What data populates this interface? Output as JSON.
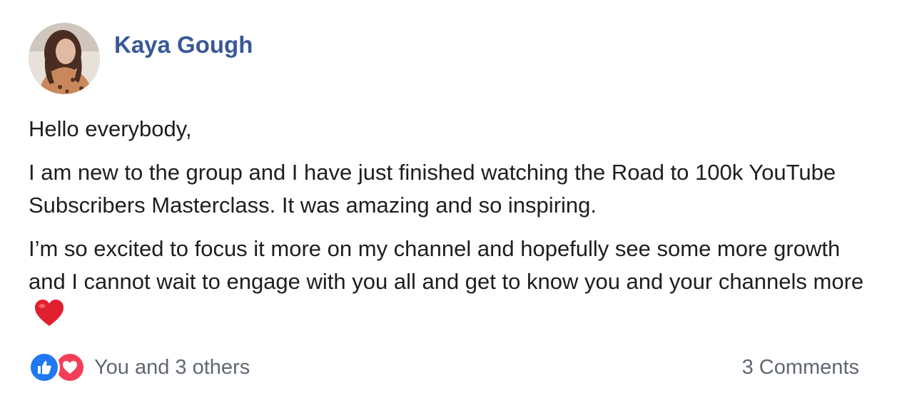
{
  "post": {
    "author_name": "Kaya Gough",
    "avatar_icon": "profile-photo",
    "paragraphs": [
      "Hello everybody,",
      "I am new to the group and I have just finished watching the Road to 100k YouTube Subscribers Masterclass. It was amazing and so inspiring.",
      "I’m so excited to focus it more on my channel and hopefully see some more growth and I cannot wait to engage with you all and get to know you and your channels more"
    ],
    "trailing_emoji": "red-heart-icon"
  },
  "footer": {
    "reactions_icons": [
      "thumbs-up-icon",
      "love-heart-icon"
    ],
    "reactions_text": "You and 3 others",
    "comments_text": "3 Comments"
  },
  "colors": {
    "author": "#385898",
    "like": "#2078f4",
    "love": "#f33e58",
    "muted": "#606770",
    "text": "#1c1e21"
  }
}
